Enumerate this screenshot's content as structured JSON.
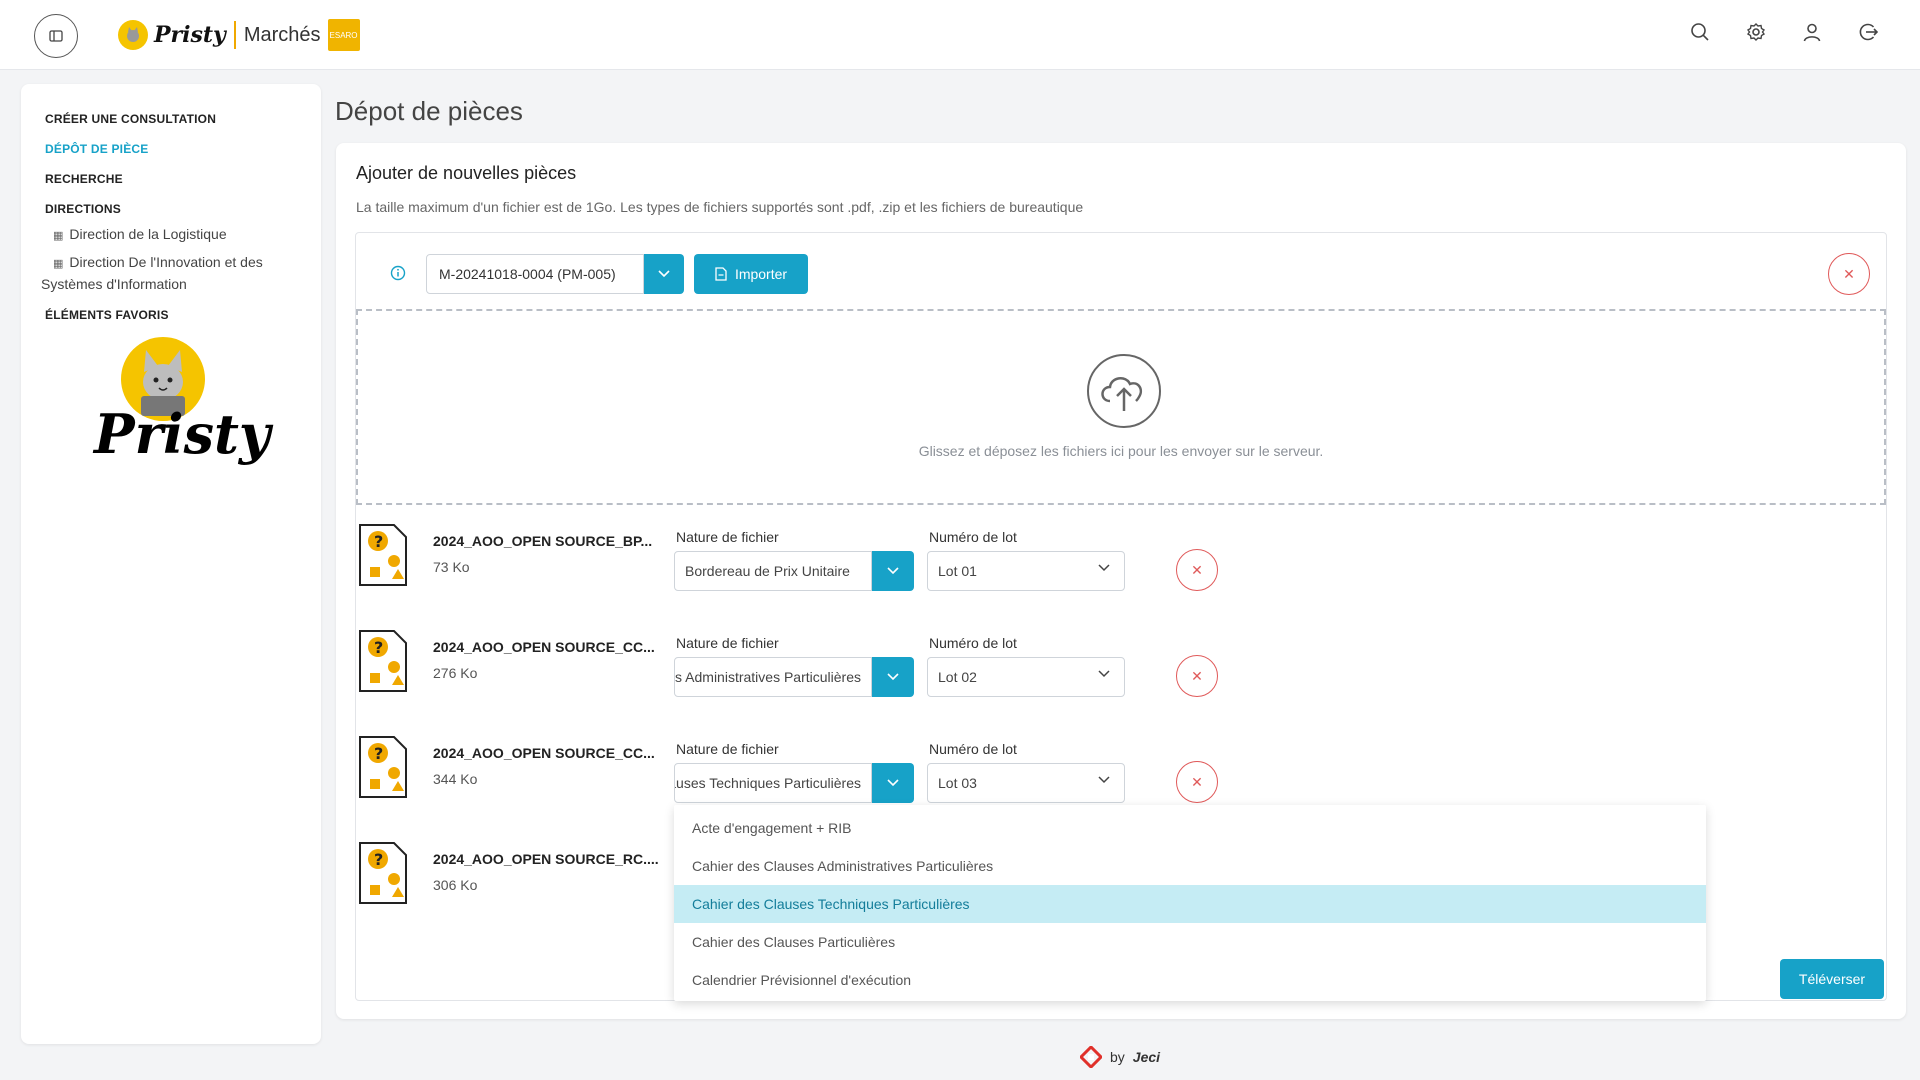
{
  "brand": {
    "name": "Pristy",
    "product": "Marchés",
    "tag": "ESARO"
  },
  "sidebar": {
    "items": [
      {
        "label": "CRÉER UNE CONSULTATION",
        "active": false
      },
      {
        "label": "DÉPÔT DE PIÈCE",
        "active": true
      },
      {
        "label": "RECHERCHE",
        "active": false
      },
      {
        "label": "DIRECTIONS",
        "active": false
      }
    ],
    "directions": [
      "Direction de la Logistique",
      "Direction De l'Innovation et des",
      "Systèmes d'Information"
    ],
    "favorites": "ÉLÉMENTS FAVORIS",
    "logo_text": "Pristy"
  },
  "page": {
    "title": "Dépot de pièces"
  },
  "card": {
    "title": "Ajouter de nouvelles pièces",
    "description": "La taille maximum d'un fichier est de 1Go. Les types de fichiers supportés sont .pdf, .zip et les fichiers de bureautique"
  },
  "toolbar": {
    "consultation_value": "M-20241018-0004 (PM-005)",
    "import_label": "Importer"
  },
  "dropzone": {
    "text": "Glissez et déposez les fichiers ici pour les envoyer sur le serveur."
  },
  "labels": {
    "nature": "Nature de fichier",
    "lot": "Numéro de lot"
  },
  "files": [
    {
      "name": "2024_AOO_OPEN SOURCE_BP...",
      "size": "73 Ko",
      "nature": "Bordereau de Prix Unitaire",
      "lot": "Lot 01"
    },
    {
      "name": "2024_AOO_OPEN SOURCE_CC...",
      "size": "276 Ko",
      "nature": "Cahier des Clauses Administratives Particulières",
      "lot": "Lot 02"
    },
    {
      "name": "2024_AOO_OPEN SOURCE_CC...",
      "size": "344 Ko",
      "nature": "Cahier des Clauses Techniques Particulières",
      "lot": "Lot 03"
    },
    {
      "name": "2024_AOO_OPEN SOURCE_RC....",
      "size": "306 Ko"
    }
  ],
  "dropdown_options": [
    "Acte d'engagement + RIB",
    "Cahier des Clauses Administratives Particulières",
    "Cahier des Clauses Techniques Particulières",
    "Cahier des Clauses Particulières",
    "Calendrier Prévisionnel d'exécution"
  ],
  "dropdown_selected_index": 2,
  "upload_label": "Téléverser",
  "footer": {
    "by": "by",
    "company": "Jeci"
  },
  "colors": {
    "accent": "#17a2c8",
    "danger": "#e05a5a",
    "selected_bg": "#c5ecf4"
  }
}
